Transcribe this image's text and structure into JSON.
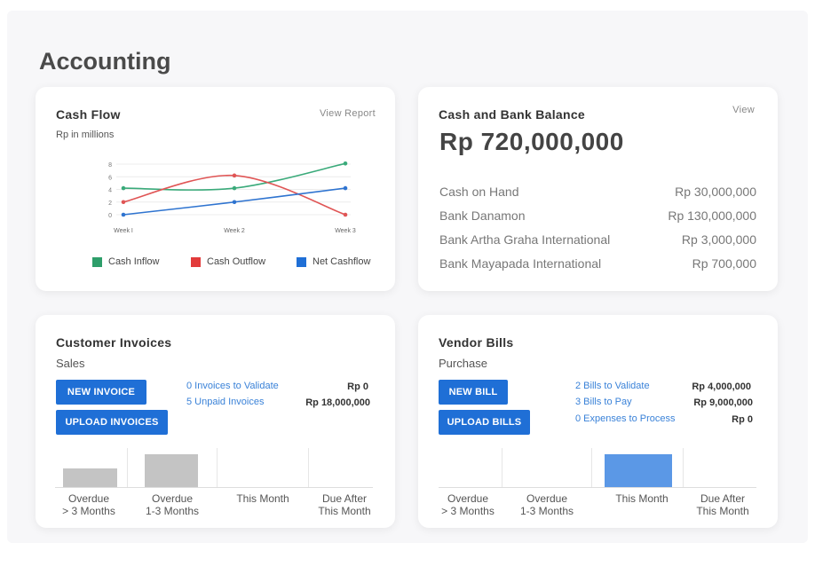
{
  "page": {
    "title": "Accounting"
  },
  "cash_flow": {
    "title": "Cash Flow",
    "view_report": "View Report",
    "units": "Rp in millions",
    "legend": [
      {
        "label": "Cash Inflow",
        "color": "#2e9e6a"
      },
      {
        "label": "Cash Outflow",
        "color": "#e23b3b"
      },
      {
        "label": "Net Cashflow",
        "color": "#1f6fd6"
      }
    ]
  },
  "chart_data": {
    "type": "line",
    "x": [
      "Week I",
      "Week 2",
      "Week 3"
    ],
    "series": [
      {
        "name": "Cash Inflow",
        "color": "#3aaa7a",
        "values": [
          4.2,
          4.2,
          8.1
        ]
      },
      {
        "name": "Cash Outflow",
        "color": "#e05555",
        "values": [
          2.0,
          6.2,
          0.0
        ]
      },
      {
        "name": "Net Cashflow",
        "color": "#2f74d0",
        "values": [
          0.0,
          2.0,
          4.2
        ]
      }
    ],
    "yticks": [
      "0",
      "2",
      "4",
      "6",
      "8"
    ],
    "ylim": [
      0,
      8
    ],
    "grid": true,
    "legend_position": "bottom"
  },
  "balance": {
    "title": "Cash and Bank Balance",
    "view": "View",
    "total": "Rp 720,000,000",
    "rows": [
      {
        "label": "Cash on Hand",
        "amount": "Rp 30,000,000"
      },
      {
        "label": "Bank Danamon",
        "amount": "Rp 130,000,000"
      },
      {
        "label": "Bank Artha Graha International",
        "amount": "Rp 3,000,000"
      },
      {
        "label": "Bank Mayapada International",
        "amount": "Rp 700,000"
      }
    ]
  },
  "invoices": {
    "title": "Customer Invoices",
    "subtitle": "Sales",
    "buttons": {
      "new": "NEW INVOICE",
      "upload": "UPLOAD INVOICES"
    },
    "tasks": [
      {
        "label": "0 Invoices to Validate",
        "amount": "Rp 0"
      },
      {
        "label": "5 Unpaid Invoices",
        "amount": "Rp 18,000,000"
      }
    ],
    "bars": [
      {
        "label1": "Overdue",
        "label2": "> 3 Months",
        "fraction": 0.47,
        "color": "#c4c4c4"
      },
      {
        "label1": "Overdue",
        "label2": "1-3 Months",
        "fraction": 0.83,
        "color": "#c4c4c4"
      },
      {
        "label1": "This Month",
        "label2": "",
        "fraction": 0,
        "color": "#c4c4c4"
      },
      {
        "label1": "Due After",
        "label2": "This Month",
        "fraction": 0,
        "color": "#c4c4c4"
      }
    ]
  },
  "bills": {
    "title": "Vendor Bills",
    "subtitle": "Purchase",
    "buttons": {
      "new": "NEW BILL",
      "upload": "UPLOAD BILLS"
    },
    "tasks": [
      {
        "label": "2 Bills to Validate",
        "amount": "Rp 4,000,000"
      },
      {
        "label": "3 Bills to Pay",
        "amount": "Rp 9,000,000"
      },
      {
        "label": "0 Expenses to Process",
        "amount": "Rp 0"
      }
    ],
    "bars": [
      {
        "label1": "Overdue",
        "label2": "> 3 Months",
        "fraction": 0,
        "color": "#5b98e6"
      },
      {
        "label1": "Overdue",
        "label2": "1-3 Months",
        "fraction": 0,
        "color": "#5b98e6"
      },
      {
        "label1": "This Month",
        "label2": "",
        "fraction": 0.83,
        "color": "#5b98e6"
      },
      {
        "label1": "Due After",
        "label2": "This Month",
        "fraction": 0,
        "color": "#5b98e6"
      }
    ]
  }
}
